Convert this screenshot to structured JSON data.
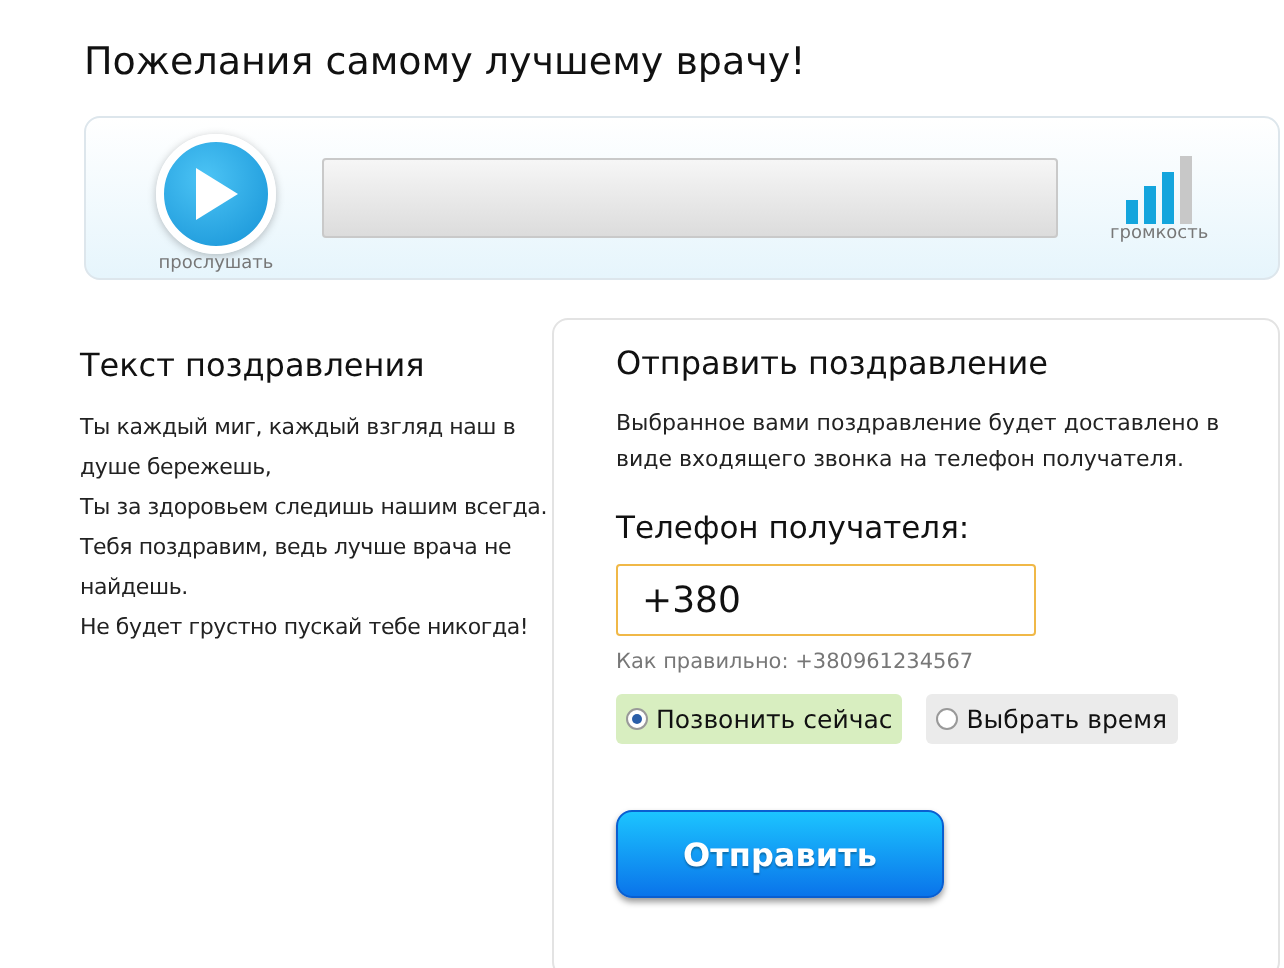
{
  "title": "Пожелания самому лучшему врачу!",
  "player": {
    "play_label": "прослушать",
    "volume": {
      "label": "громкость",
      "level": 0.75
    }
  },
  "greeting": {
    "heading": "Текст поздравления",
    "verses": [
      "Ты каждый миг, каждый взгляд наш в душе бережешь,",
      "Ты за здоровьем следишь нашим всегда.",
      "Тебя поздравим, ведь лучше врача не найдешь.",
      "Не будет грустно пускай тебе никогда!"
    ]
  },
  "send": {
    "heading": "Отправить поздравление",
    "description": "Выбранное вами поздравление будет доставлено в виде входящего звонка на телефон получателя.",
    "phone_label": "Телефон получателя:",
    "phone_value": "+380",
    "hint": "Как правильно: +380961234567",
    "options": [
      {
        "label": "Позвонить сейчас",
        "selected": true
      },
      {
        "label": "Выбрать время",
        "selected": false
      }
    ],
    "button": "Отправить"
  }
}
